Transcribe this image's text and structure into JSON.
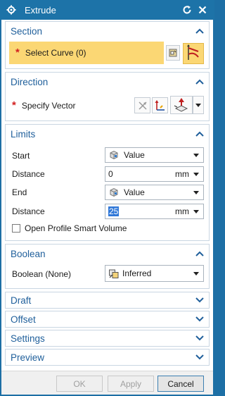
{
  "window": {
    "title": "Extrude"
  },
  "section": {
    "title": "Section",
    "select_curve_label": "Select Curve (0)"
  },
  "direction": {
    "title": "Direction",
    "specify_vector_label": "Specify Vector"
  },
  "limits": {
    "title": "Limits",
    "start_label": "Start",
    "start_value": "Value",
    "distance1_label": "Distance",
    "distance1_value": "0",
    "distance1_unit": "mm",
    "end_label": "End",
    "end_value": "Value",
    "distance2_label": "Distance",
    "distance2_value": "25",
    "distance2_unit": "mm",
    "open_profile_label": "Open Profile Smart Volume",
    "open_profile_checked": false
  },
  "boolean": {
    "title": "Boolean",
    "label": "Boolean (None)",
    "value": "Inferred"
  },
  "collapsed_sections": {
    "draft": "Draft",
    "offset": "Offset",
    "settings": "Settings",
    "preview": "Preview"
  },
  "buttons": {
    "ok": "OK",
    "apply": "Apply",
    "cancel": "Cancel"
  },
  "colors": {
    "titlebar": "#1d73a8",
    "section_header": "#1f5f9b",
    "required_star": "#d21f1f",
    "highlight_row": "#fbd774"
  }
}
